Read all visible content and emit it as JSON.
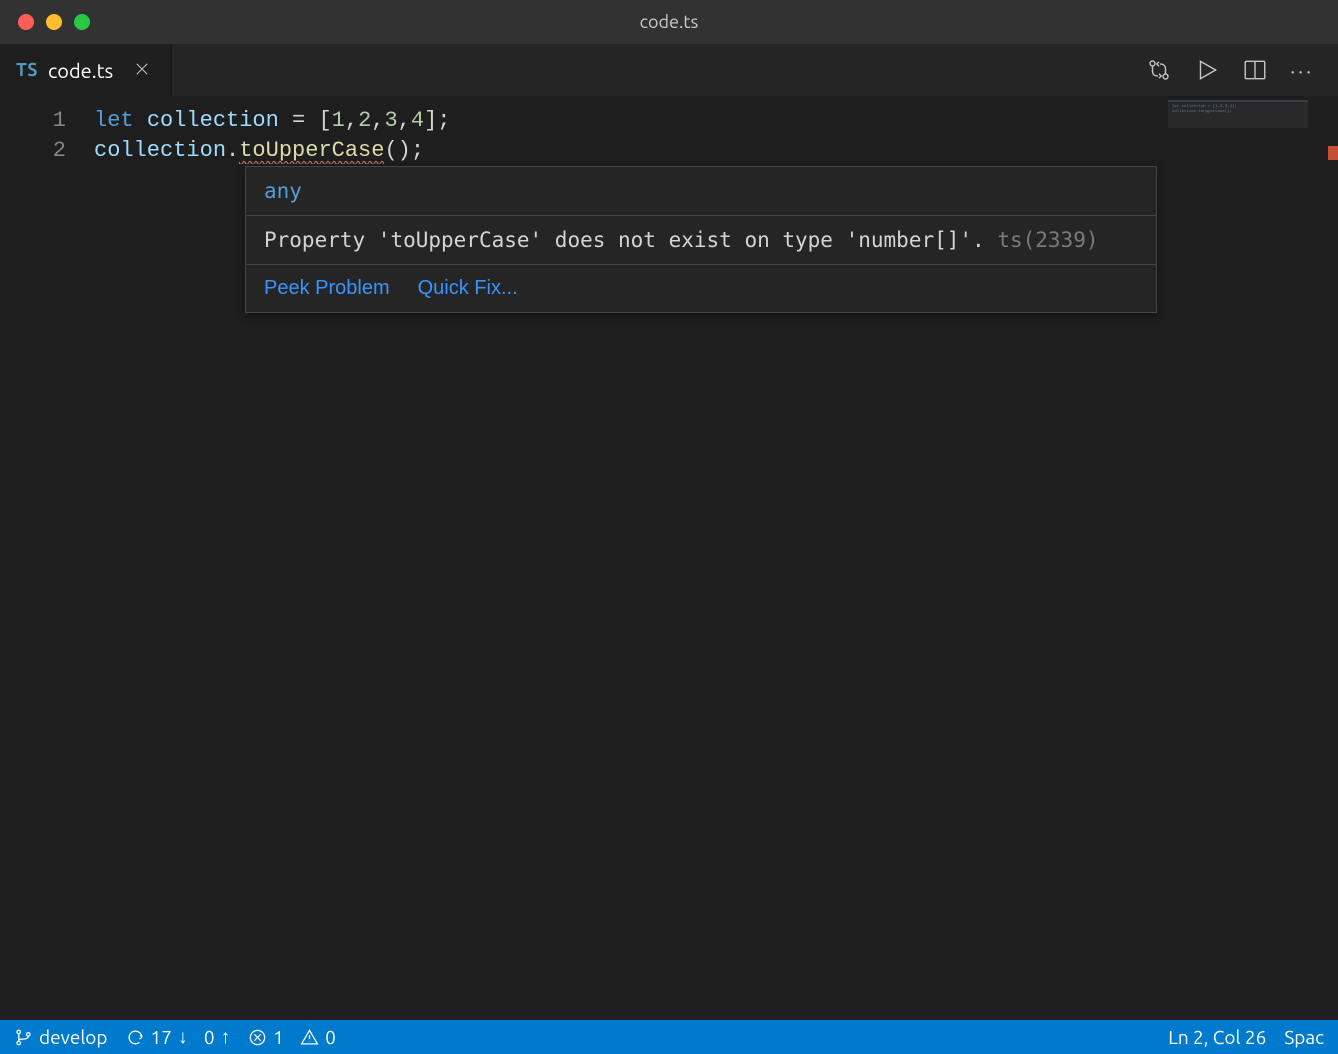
{
  "window": {
    "title": "code.ts"
  },
  "tab": {
    "icon": "TS",
    "label": "code.ts"
  },
  "code": {
    "lines": [
      {
        "num": "1"
      },
      {
        "num": "2"
      }
    ],
    "l1": {
      "kw": "let",
      "var": "collection",
      "eq": " = [",
      "n1": "1",
      "c1": ",",
      "n2": "2",
      "c2": ",",
      "n3": "3",
      "c3": ",",
      "n4": "4",
      "end": "];"
    },
    "l2": {
      "obj": "collection",
      "dot": ".",
      "method": "toUpperCase",
      "tail": "();"
    }
  },
  "hover": {
    "type": "any",
    "message_pre": "Property '",
    "message_prop": "toUpperCase",
    "message_mid": "' does not exist on type '",
    "message_type": "number[]",
    "message_post": "'. ",
    "code": "ts(2339)",
    "actions": {
      "peek": "Peek Problem",
      "fix": "Quick Fix..."
    }
  },
  "status": {
    "branch": "develop",
    "sync_down": "17",
    "sync_up": "0",
    "errors": "1",
    "warnings": "0",
    "position": "Ln 2, Col 26",
    "indent": "Spac"
  }
}
